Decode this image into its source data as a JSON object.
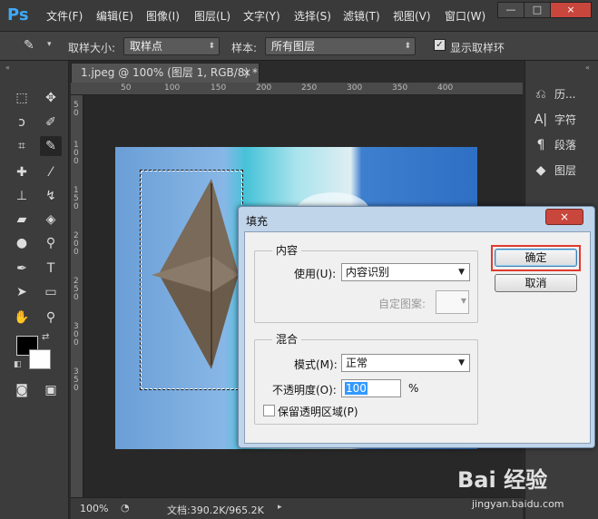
{
  "menubar": {
    "logo": "Ps",
    "items": [
      "文件(F)",
      "编辑(E)",
      "图像(I)",
      "图层(L)",
      "文字(Y)",
      "选择(S)",
      "滤镜(T)",
      "视图(V)",
      "窗口(W)"
    ],
    "window_controls": [
      "—",
      "□",
      "×"
    ]
  },
  "options": {
    "sample_size_label": "取样大小:",
    "sample_size_value": "取样点",
    "sample_label": "样本:",
    "sample_value": "所有图层",
    "show_ring_label": "显示取样环",
    "show_ring_checked": true
  },
  "right_panel": {
    "items": [
      {
        "icon": "history-icon",
        "label": "历..."
      },
      {
        "icon": "character-icon",
        "label": "字符"
      },
      {
        "icon": "paragraph-icon",
        "label": "段落"
      },
      {
        "icon": "layers-icon",
        "label": "图层"
      }
    ]
  },
  "document": {
    "tab_title": "1.jpeg @ 100% (图层 1, RGB/8) *",
    "tab_close": "×",
    "ruler_top": [
      "50",
      "100",
      "150",
      "200",
      "250",
      "300",
      "350",
      "400"
    ],
    "ruler_left": [
      "5",
      "0",
      "1",
      "0",
      "0",
      "1",
      "5",
      "0",
      "2",
      "0",
      "0",
      "2",
      "5",
      "0",
      "3",
      "0",
      "0",
      "3",
      "5",
      "0"
    ]
  },
  "status": {
    "zoom": "100%",
    "doc_info": "文档:390.2K/965.2K"
  },
  "dialog": {
    "title": "填充",
    "close": "×",
    "contents_group": "内容",
    "use_label": "使用(U):",
    "use_value": "内容识别",
    "pattern_label": "自定图案:",
    "blending_group": "混合",
    "mode_label": "模式(M):",
    "mode_value": "正常",
    "opacity_label": "不透明度(O):",
    "opacity_value": "100",
    "opacity_unit": "%",
    "preserve_label": "保留透明区域(P)",
    "preserve_checked": false,
    "ok_label": "确定",
    "cancel_label": "取消"
  },
  "watermark": {
    "logo": "Bai 经验",
    "url": "jingyan.baidu.com"
  }
}
